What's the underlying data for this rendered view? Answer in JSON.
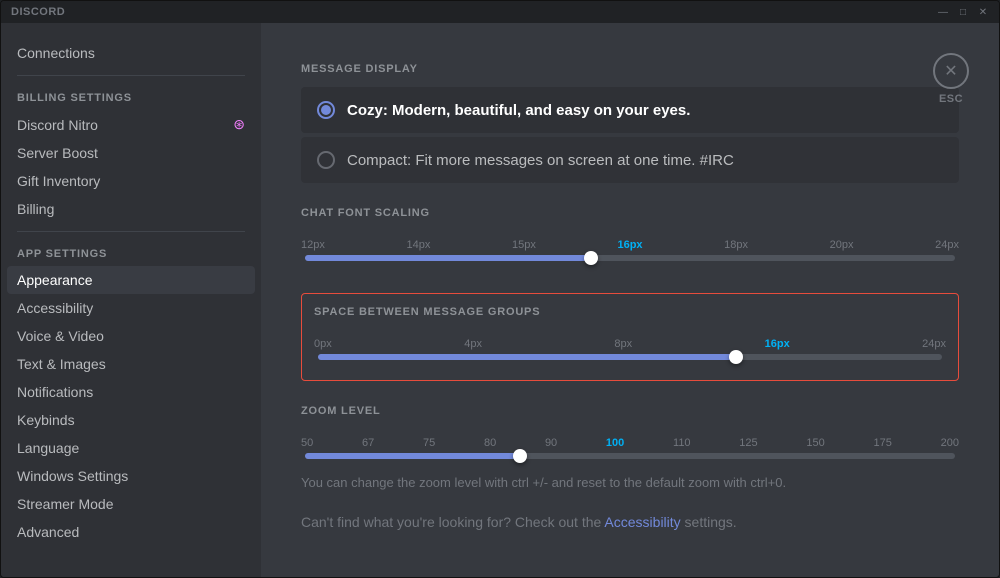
{
  "titlebar": {
    "title": "DISCORD",
    "minimize": "—",
    "maximize": "□",
    "close": "✕"
  },
  "sidebar": {
    "billing_section_label": "BILLING SETTINGS",
    "app_section_label": "APP SETTINGS",
    "items_top": [
      {
        "id": "connections",
        "label": "Connections",
        "active": false
      },
      {
        "id": "billing-divider",
        "type": "divider"
      }
    ],
    "billing_items": [
      {
        "id": "discord-nitro",
        "label": "Discord Nitro",
        "icon": "⊛",
        "active": false
      },
      {
        "id": "server-boost",
        "label": "Server Boost",
        "active": false
      },
      {
        "id": "gift-inventory",
        "label": "Gift Inventory",
        "active": false
      },
      {
        "id": "billing",
        "label": "Billing",
        "active": false
      }
    ],
    "app_items": [
      {
        "id": "appearance",
        "label": "Appearance",
        "active": true
      },
      {
        "id": "accessibility",
        "label": "Accessibility",
        "active": false
      },
      {
        "id": "voice-video",
        "label": "Voice & Video",
        "active": false
      },
      {
        "id": "text-images",
        "label": "Text & Images",
        "active": false
      },
      {
        "id": "notifications",
        "label": "Notifications",
        "active": false
      },
      {
        "id": "keybinds",
        "label": "Keybinds",
        "active": false
      },
      {
        "id": "language",
        "label": "Language",
        "active": false
      },
      {
        "id": "windows-settings",
        "label": "Windows Settings",
        "active": false
      },
      {
        "id": "streamer-mode",
        "label": "Streamer Mode",
        "active": false
      },
      {
        "id": "advanced",
        "label": "Advanced",
        "active": false
      }
    ]
  },
  "content": {
    "esc": "ESC",
    "message_display": {
      "section_title": "MESSAGE DISPLAY",
      "options": [
        {
          "id": "cozy",
          "label": "Cozy: Modern, beautiful, and easy on your eyes.",
          "selected": true
        },
        {
          "id": "compact",
          "label": "Compact: Fit more messages on screen at one time. #IRC",
          "selected": false
        }
      ]
    },
    "chat_font_scaling": {
      "section_title": "CHAT FONT SCALING",
      "ticks": [
        "12px",
        "14px",
        "15px",
        "16px",
        "18px",
        "20px",
        "24px"
      ],
      "active_tick": "16px",
      "active_tick_index": 3,
      "fill_percent": 44
    },
    "space_between_messages": {
      "section_title": "SPACE BETWEEN MESSAGE GROUPS",
      "ticks": [
        "0px",
        "4px",
        "8px",
        "16px",
        "24px"
      ],
      "active_tick": "16px",
      "active_tick_index": 3,
      "fill_percent": 67
    },
    "zoom_level": {
      "section_title": "ZOOM LEVEL",
      "ticks": [
        "50",
        "67",
        "75",
        "80",
        "90",
        "100",
        "110",
        "125",
        "150",
        "175",
        "200"
      ],
      "active_tick": "100",
      "active_tick_index": 5,
      "fill_percent": 33
    },
    "zoom_note": "You can change the zoom level with ctrl +/- and reset to the default zoom with ctrl+0.",
    "accessibility_note_prefix": "Can't find what you're looking for? Check out the ",
    "accessibility_link": "Accessibility",
    "accessibility_note_suffix": " settings."
  }
}
